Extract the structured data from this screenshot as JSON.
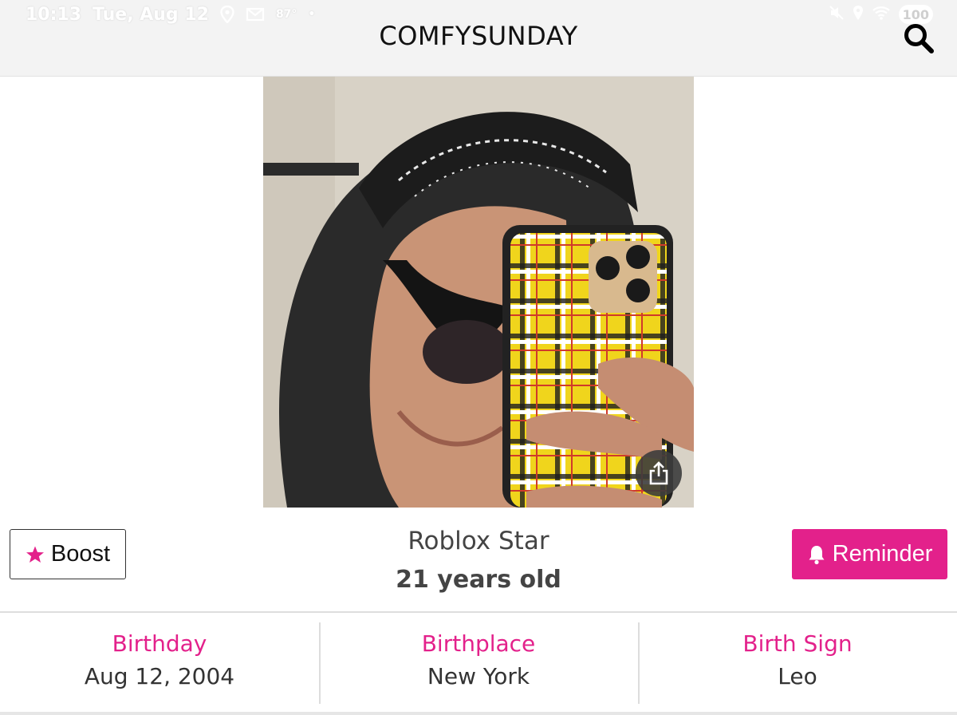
{
  "status_bar": {
    "time": "10:13",
    "date": "Tue, Aug 12",
    "temperature": "87°",
    "battery": "100"
  },
  "header": {
    "title": "COMFYSUNDAY"
  },
  "profile": {
    "name": "Roblox Star",
    "age": "21 years old"
  },
  "actions": {
    "boost_label": "Boost",
    "reminder_label": "Reminder"
  },
  "info": [
    {
      "label": "Birthday",
      "value": "Aug 12, 2004"
    },
    {
      "label": "Birthplace",
      "value": "New York"
    },
    {
      "label": "Birth Sign",
      "value": "Leo"
    }
  ],
  "colors": {
    "accent": "#e3218b",
    "topbar": "#f3f3f3",
    "text": "#444444"
  },
  "icons": {
    "search": "search-icon",
    "share": "share-icon",
    "boost": "star-icon",
    "reminder": "bell-icon"
  }
}
